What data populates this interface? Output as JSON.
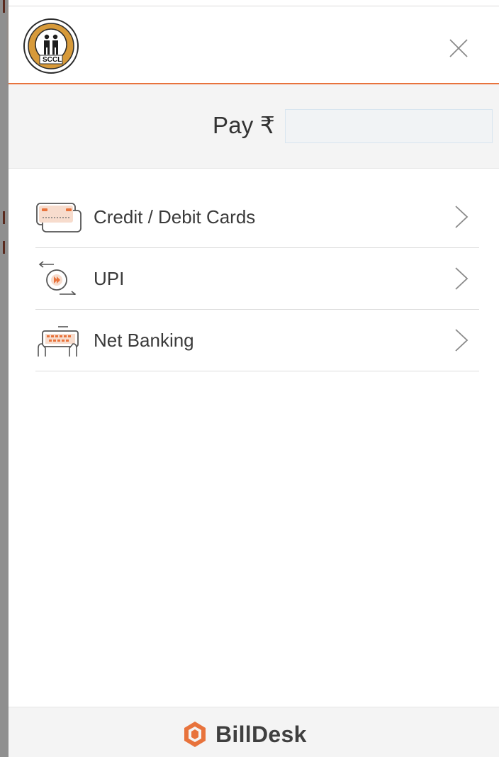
{
  "header": {
    "logo_text": "SCCL",
    "close_icon": "close-icon"
  },
  "pay": {
    "label": "Pay ₹",
    "amount_value": ""
  },
  "methods": [
    {
      "label": "Credit / Debit Cards",
      "icon": "card-icon"
    },
    {
      "label": "UPI",
      "icon": "upi-icon"
    },
    {
      "label": "Net Banking",
      "icon": "net-banking-icon"
    }
  ],
  "footer": {
    "brand_name": "BillDesk",
    "brand_icon": "billdesk-logo-icon"
  },
  "colors": {
    "accent": "#e8733c",
    "text": "#3a3a3a",
    "panel": "#f4f4f4"
  }
}
